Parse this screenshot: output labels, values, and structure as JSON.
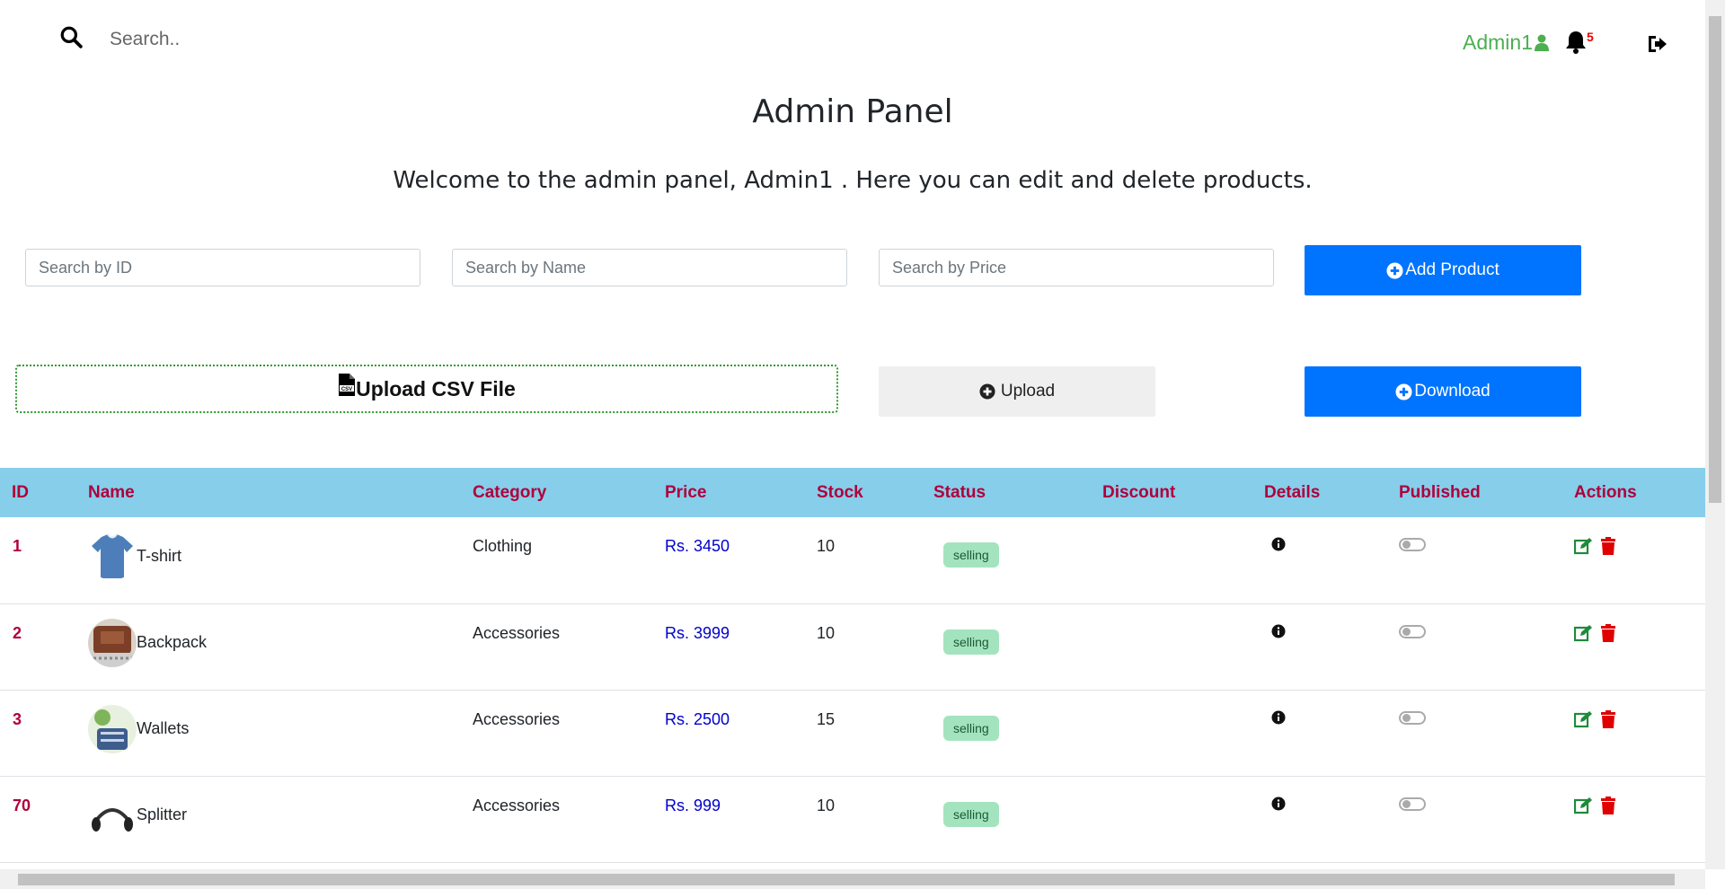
{
  "topbar": {
    "search_placeholder": "Search..",
    "user_name": "Admin1",
    "notification_count": "5"
  },
  "header": {
    "title": "Admin Panel",
    "welcome": "Welcome to the admin panel, Admin1 . Here you can edit and delete products."
  },
  "filters": {
    "id_placeholder": "Search by ID",
    "name_placeholder": "Search by Name",
    "price_placeholder": "Search by Price"
  },
  "actions": {
    "add_product": "Add Product",
    "upload_csv": "Upload CSV File",
    "upload": "Upload",
    "download": "Download"
  },
  "table": {
    "columns": [
      "ID",
      "Name",
      "Category",
      "Price",
      "Stock",
      "Status",
      "Discount",
      "Details",
      "Published",
      "Actions"
    ],
    "rows": [
      {
        "id": "1",
        "name": "T-shirt",
        "category": "Clothing",
        "price": "Rs. 3450",
        "stock": "10",
        "status": "selling",
        "discount": "",
        "published": false
      },
      {
        "id": "2",
        "name": "Backpack",
        "category": "Accessories",
        "price": "Rs. 3999",
        "stock": "10",
        "status": "selling",
        "discount": "",
        "published": false
      },
      {
        "id": "3",
        "name": "Wallets",
        "category": "Accessories",
        "price": "Rs. 2500",
        "stock": "15",
        "status": "selling",
        "discount": "",
        "published": false
      },
      {
        "id": "70",
        "name": "Splitter",
        "category": "Accessories",
        "price": "Rs. 999",
        "stock": "10",
        "status": "selling",
        "discount": "",
        "published": false
      }
    ]
  },
  "colors": {
    "primary_button": "#0074ff",
    "table_header": "#87ceeb",
    "header_text": "#b0003a",
    "price_text": "#0000cc",
    "badge_bg": "#a3e4bf",
    "edit_icon": "#1f8a3a",
    "delete_icon": "#e00000",
    "user_green": "#4caf50"
  }
}
